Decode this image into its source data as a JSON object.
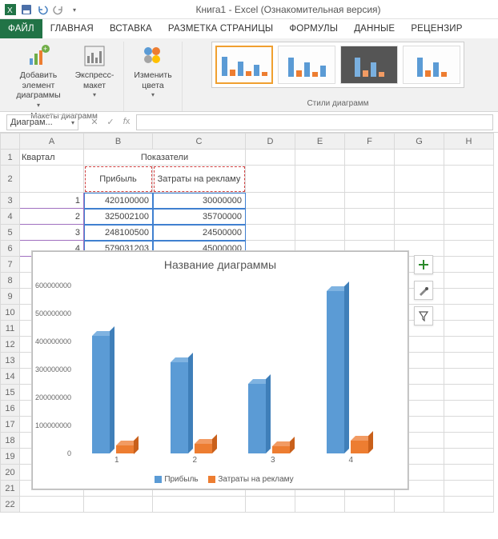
{
  "title": "Книга1 - Excel (Ознакомительная версия)",
  "tabs": {
    "file": "ФАЙЛ",
    "home": "ГЛАВНАЯ",
    "insert": "ВСТАВКА",
    "layout": "РАЗМЕТКА СТРАНИЦЫ",
    "formulas": "ФОРМУЛЫ",
    "data": "ДАННЫЕ",
    "review": "РЕЦЕНЗИР"
  },
  "ribbon": {
    "add_element": "Добавить элемент диаграммы",
    "quick_layout": "Экспресс-макет",
    "change_colors": "Изменить цвета",
    "group_layout": "Макеты диаграмм",
    "group_styles": "Стили диаграмм"
  },
  "namebox": "Диаграм...",
  "columns": [
    "A",
    "B",
    "C",
    "D",
    "E",
    "F",
    "G",
    "H"
  ],
  "rows": [
    "1",
    "2",
    "3",
    "4",
    "5",
    "6",
    "7",
    "8",
    "9",
    "10",
    "11",
    "12",
    "13",
    "14",
    "15",
    "16",
    "17",
    "18",
    "19",
    "20",
    "21",
    "22"
  ],
  "cells": {
    "A1": "Квартал",
    "B1": "Показатели",
    "B2": "Прибыль",
    "C2": "Затраты на рекламу",
    "A3": "1",
    "B3": "420100000",
    "C3": "30000000",
    "A4": "2",
    "B4": "325002100",
    "C4": "35700000",
    "A5": "3",
    "B5": "248100500",
    "C5": "24500000",
    "A6": "4",
    "B6": "579031203",
    "C6": "45000000"
  },
  "chart_data": {
    "type": "bar",
    "title": "Название диаграммы",
    "categories": [
      "1",
      "2",
      "3",
      "4"
    ],
    "series": [
      {
        "name": "Прибыль",
        "values": [
          420100000,
          325002100,
          248100500,
          579031203
        ],
        "color": "#5b9bd5"
      },
      {
        "name": "Затраты на рекламу",
        "values": [
          30000000,
          35700000,
          24500000,
          45000000
        ],
        "color": "#ed7d31"
      }
    ],
    "ylim": [
      0,
      600000000
    ],
    "yticks": [
      0,
      100000000,
      200000000,
      300000000,
      400000000,
      500000000,
      600000000
    ],
    "xlabel": "",
    "ylabel": ""
  },
  "chart_side": {
    "plus": "+"
  }
}
